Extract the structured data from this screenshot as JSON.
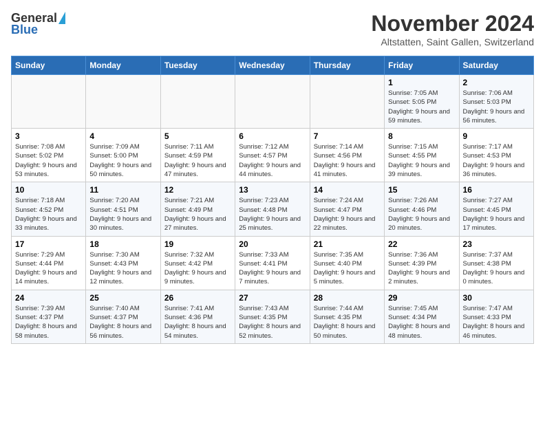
{
  "header": {
    "logo_general": "General",
    "logo_blue": "Blue",
    "title": "November 2024",
    "subtitle": "Altstatten, Saint Gallen, Switzerland"
  },
  "days_of_week": [
    "Sunday",
    "Monday",
    "Tuesday",
    "Wednesday",
    "Thursday",
    "Friday",
    "Saturday"
  ],
  "weeks": [
    [
      {
        "day": "",
        "info": ""
      },
      {
        "day": "",
        "info": ""
      },
      {
        "day": "",
        "info": ""
      },
      {
        "day": "",
        "info": ""
      },
      {
        "day": "",
        "info": ""
      },
      {
        "day": "1",
        "info": "Sunrise: 7:05 AM\nSunset: 5:05 PM\nDaylight: 9 hours and 59 minutes."
      },
      {
        "day": "2",
        "info": "Sunrise: 7:06 AM\nSunset: 5:03 PM\nDaylight: 9 hours and 56 minutes."
      }
    ],
    [
      {
        "day": "3",
        "info": "Sunrise: 7:08 AM\nSunset: 5:02 PM\nDaylight: 9 hours and 53 minutes."
      },
      {
        "day": "4",
        "info": "Sunrise: 7:09 AM\nSunset: 5:00 PM\nDaylight: 9 hours and 50 minutes."
      },
      {
        "day": "5",
        "info": "Sunrise: 7:11 AM\nSunset: 4:59 PM\nDaylight: 9 hours and 47 minutes."
      },
      {
        "day": "6",
        "info": "Sunrise: 7:12 AM\nSunset: 4:57 PM\nDaylight: 9 hours and 44 minutes."
      },
      {
        "day": "7",
        "info": "Sunrise: 7:14 AM\nSunset: 4:56 PM\nDaylight: 9 hours and 41 minutes."
      },
      {
        "day": "8",
        "info": "Sunrise: 7:15 AM\nSunset: 4:55 PM\nDaylight: 9 hours and 39 minutes."
      },
      {
        "day": "9",
        "info": "Sunrise: 7:17 AM\nSunset: 4:53 PM\nDaylight: 9 hours and 36 minutes."
      }
    ],
    [
      {
        "day": "10",
        "info": "Sunrise: 7:18 AM\nSunset: 4:52 PM\nDaylight: 9 hours and 33 minutes."
      },
      {
        "day": "11",
        "info": "Sunrise: 7:20 AM\nSunset: 4:51 PM\nDaylight: 9 hours and 30 minutes."
      },
      {
        "day": "12",
        "info": "Sunrise: 7:21 AM\nSunset: 4:49 PM\nDaylight: 9 hours and 27 minutes."
      },
      {
        "day": "13",
        "info": "Sunrise: 7:23 AM\nSunset: 4:48 PM\nDaylight: 9 hours and 25 minutes."
      },
      {
        "day": "14",
        "info": "Sunrise: 7:24 AM\nSunset: 4:47 PM\nDaylight: 9 hours and 22 minutes."
      },
      {
        "day": "15",
        "info": "Sunrise: 7:26 AM\nSunset: 4:46 PM\nDaylight: 9 hours and 20 minutes."
      },
      {
        "day": "16",
        "info": "Sunrise: 7:27 AM\nSunset: 4:45 PM\nDaylight: 9 hours and 17 minutes."
      }
    ],
    [
      {
        "day": "17",
        "info": "Sunrise: 7:29 AM\nSunset: 4:44 PM\nDaylight: 9 hours and 14 minutes."
      },
      {
        "day": "18",
        "info": "Sunrise: 7:30 AM\nSunset: 4:43 PM\nDaylight: 9 hours and 12 minutes."
      },
      {
        "day": "19",
        "info": "Sunrise: 7:32 AM\nSunset: 4:42 PM\nDaylight: 9 hours and 9 minutes."
      },
      {
        "day": "20",
        "info": "Sunrise: 7:33 AM\nSunset: 4:41 PM\nDaylight: 9 hours and 7 minutes."
      },
      {
        "day": "21",
        "info": "Sunrise: 7:35 AM\nSunset: 4:40 PM\nDaylight: 9 hours and 5 minutes."
      },
      {
        "day": "22",
        "info": "Sunrise: 7:36 AM\nSunset: 4:39 PM\nDaylight: 9 hours and 2 minutes."
      },
      {
        "day": "23",
        "info": "Sunrise: 7:37 AM\nSunset: 4:38 PM\nDaylight: 9 hours and 0 minutes."
      }
    ],
    [
      {
        "day": "24",
        "info": "Sunrise: 7:39 AM\nSunset: 4:37 PM\nDaylight: 8 hours and 58 minutes."
      },
      {
        "day": "25",
        "info": "Sunrise: 7:40 AM\nSunset: 4:37 PM\nDaylight: 8 hours and 56 minutes."
      },
      {
        "day": "26",
        "info": "Sunrise: 7:41 AM\nSunset: 4:36 PM\nDaylight: 8 hours and 54 minutes."
      },
      {
        "day": "27",
        "info": "Sunrise: 7:43 AM\nSunset: 4:35 PM\nDaylight: 8 hours and 52 minutes."
      },
      {
        "day": "28",
        "info": "Sunrise: 7:44 AM\nSunset: 4:35 PM\nDaylight: 8 hours and 50 minutes."
      },
      {
        "day": "29",
        "info": "Sunrise: 7:45 AM\nSunset: 4:34 PM\nDaylight: 8 hours and 48 minutes."
      },
      {
        "day": "30",
        "info": "Sunrise: 7:47 AM\nSunset: 4:33 PM\nDaylight: 8 hours and 46 minutes."
      }
    ]
  ]
}
